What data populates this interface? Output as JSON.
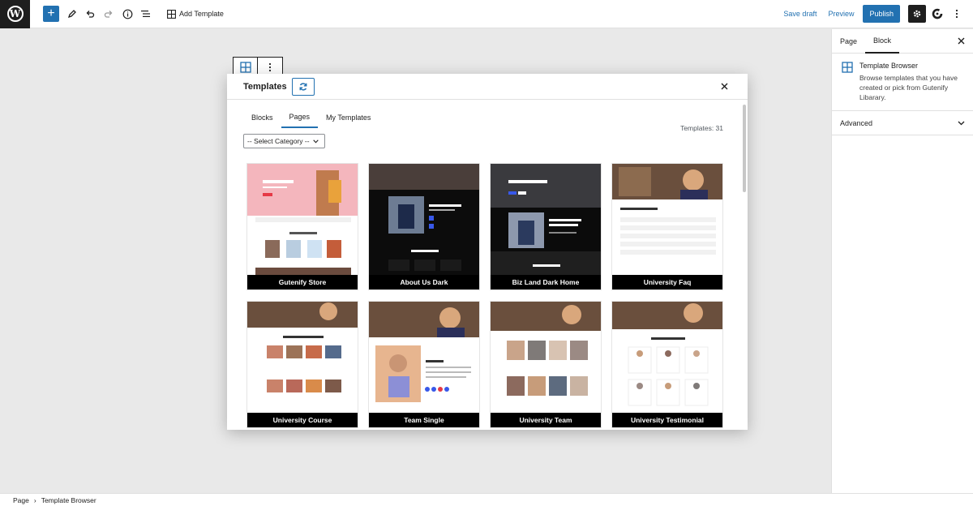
{
  "toolbar": {
    "add_template_label": "Add Template",
    "save_draft_label": "Save draft",
    "preview_label": "Preview",
    "publish_label": "Publish"
  },
  "sidebar": {
    "tabs": [
      {
        "label": "Page"
      },
      {
        "label": "Block"
      }
    ],
    "block_title": "Template Browser",
    "block_description": "Browse templates that you have created or pick from Gutenify Libarary.",
    "advanced_label": "Advanced"
  },
  "modal": {
    "title": "Templates",
    "tabs": [
      {
        "label": "Blocks"
      },
      {
        "label": "Pages"
      },
      {
        "label": "My Templates"
      }
    ],
    "active_tab": "Pages",
    "count_label": "Templates: 31",
    "select_category": "-- Select Category --",
    "templates": [
      {
        "name": "Gutenify Store"
      },
      {
        "name": "About Us Dark"
      },
      {
        "name": "Biz Land Dark Home"
      },
      {
        "name": "University Faq"
      },
      {
        "name": "University Course"
      },
      {
        "name": "Team Single"
      },
      {
        "name": "University Team"
      },
      {
        "name": "University Testimonial"
      }
    ]
  },
  "footer": {
    "breadcrumb_root": "Page",
    "breadcrumb_current": "Template Browser"
  },
  "colors": {
    "accent": "#2271b1",
    "dark": "#1e1e1e",
    "canvas": "#e9e9e9"
  }
}
